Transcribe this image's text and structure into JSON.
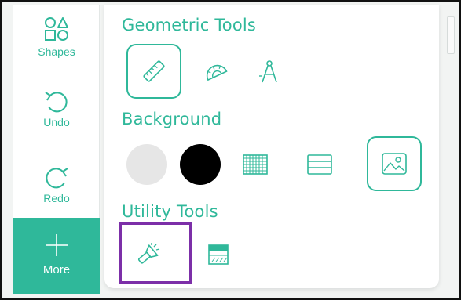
{
  "toolbar": {
    "shapes_label": "Shapes",
    "undo_label": "Undo",
    "redo_label": "Redo",
    "more_label": "More"
  },
  "panel": {
    "geometric_title": "Geometric Tools",
    "background_title": "Background",
    "utility_title": "Utility Tools",
    "geometric_tools": [
      "ruler-icon",
      "protractor-icon",
      "compass-icon"
    ],
    "backgrounds": [
      "light-gray-background",
      "black-background",
      "grid-background",
      "lined-background",
      "image-background"
    ],
    "utility_tools": [
      "flashlight-icon",
      "screen-shade-icon"
    ]
  },
  "colors": {
    "accent": "#2fb89a",
    "highlight": "#7c2fa8",
    "light_gray": "#e6e6e6",
    "black": "#000000"
  }
}
